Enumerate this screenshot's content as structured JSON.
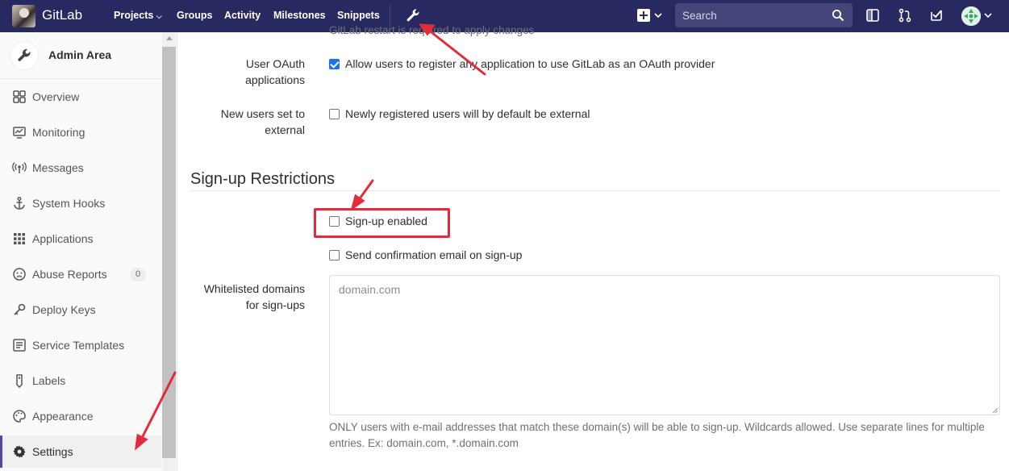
{
  "topbar": {
    "brand": "GitLab",
    "nav": [
      "Projects",
      "Groups",
      "Activity",
      "Milestones",
      "Snippets"
    ],
    "search_placeholder": "Search"
  },
  "sidebar": {
    "title": "Admin Area",
    "items": [
      {
        "label": "Overview",
        "icon": "overview-icon"
      },
      {
        "label": "Monitoring",
        "icon": "monitoring-icon"
      },
      {
        "label": "Messages",
        "icon": "messages-icon"
      },
      {
        "label": "System Hooks",
        "icon": "anchor-icon"
      },
      {
        "label": "Applications",
        "icon": "applications-icon"
      },
      {
        "label": "Abuse Reports",
        "icon": "abuse-icon",
        "count": "0"
      },
      {
        "label": "Deploy Keys",
        "icon": "key-icon"
      },
      {
        "label": "Service Templates",
        "icon": "template-icon"
      },
      {
        "label": "Labels",
        "icon": "label-icon"
      },
      {
        "label": "Appearance",
        "icon": "palette-icon"
      },
      {
        "label": "Settings",
        "icon": "gear-icon",
        "active": true
      }
    ]
  },
  "main": {
    "cut_text": "GitLab restart is required to apply changes",
    "oauth": {
      "label_line1": "User OAuth",
      "label_line2": "applications",
      "checkbox_text": "Allow users to register any application to use GitLab as an OAuth provider",
      "checked": true
    },
    "external": {
      "label_line1": "New users set to",
      "label_line2": "external",
      "checkbox_text": "Newly registered users will by default be external",
      "checked": false
    },
    "section_title": "Sign-up Restrictions",
    "signup_enabled": {
      "text": "Sign-up enabled",
      "checked": false
    },
    "send_confirmation": {
      "text": "Send confirmation email on sign-up",
      "checked": false
    },
    "whitelist": {
      "label_line1": "Whitelisted domains",
      "label_line2": "for sign-ups",
      "placeholder": "domain.com",
      "help_text": "ONLY users with e-mail addresses that match these domain(s) will be able to sign-up. Wildcards allowed. Use separate lines for multiple entries. Ex: domain.com, *.domain.com"
    }
  },
  "colors": {
    "topbar": "#292961",
    "annotation_red": "#e32b3b",
    "active_accent": "#4b4ba3"
  }
}
